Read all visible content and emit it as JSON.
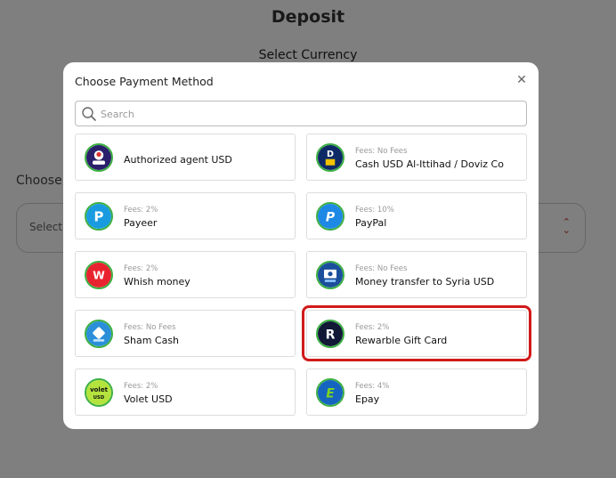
{
  "background": {
    "title": "Deposit",
    "select_currency": "Select Currency",
    "choose_label": "Choose P",
    "select_placeholder": "Select P"
  },
  "modal": {
    "title": "Choose Payment Method",
    "search_placeholder": "Search",
    "search_value": "",
    "methods": [
      {
        "fees": "",
        "name": "Authorized agent USD",
        "icon": "authorized-agent-icon"
      },
      {
        "fees": "Fees: No Fees",
        "name": "Cash USD Al-Ittihad / Doviz Co",
        "icon": "doviz-icon"
      },
      {
        "fees": "Fees: 2%",
        "name": "Payeer",
        "icon": "payeer-icon"
      },
      {
        "fees": "Fees: 10%",
        "name": "PayPal",
        "icon": "paypal-icon"
      },
      {
        "fees": "Fees: 2%",
        "name": "Whish money",
        "icon": "whish-icon"
      },
      {
        "fees": "Fees: No Fees",
        "name": "Money transfer to Syria USD",
        "icon": "money-transfer-icon"
      },
      {
        "fees": "Fees: No Fees",
        "name": "Sham Cash",
        "icon": "sham-cash-icon"
      },
      {
        "fees": "Fees: 2%",
        "name": "Rewarble Gift Card",
        "icon": "rewarble-icon",
        "highlighted": true
      },
      {
        "fees": "Fees: 2%",
        "name": "Volet USD",
        "icon": "volet-icon"
      },
      {
        "fees": "Fees: 4%",
        "name": "Epay",
        "icon": "epay-icon"
      }
    ]
  },
  "colors": {
    "overlay": "#000000",
    "icon_ring": "#3cb043",
    "highlight": "#d11a1a",
    "chevron": "#c0392b"
  }
}
